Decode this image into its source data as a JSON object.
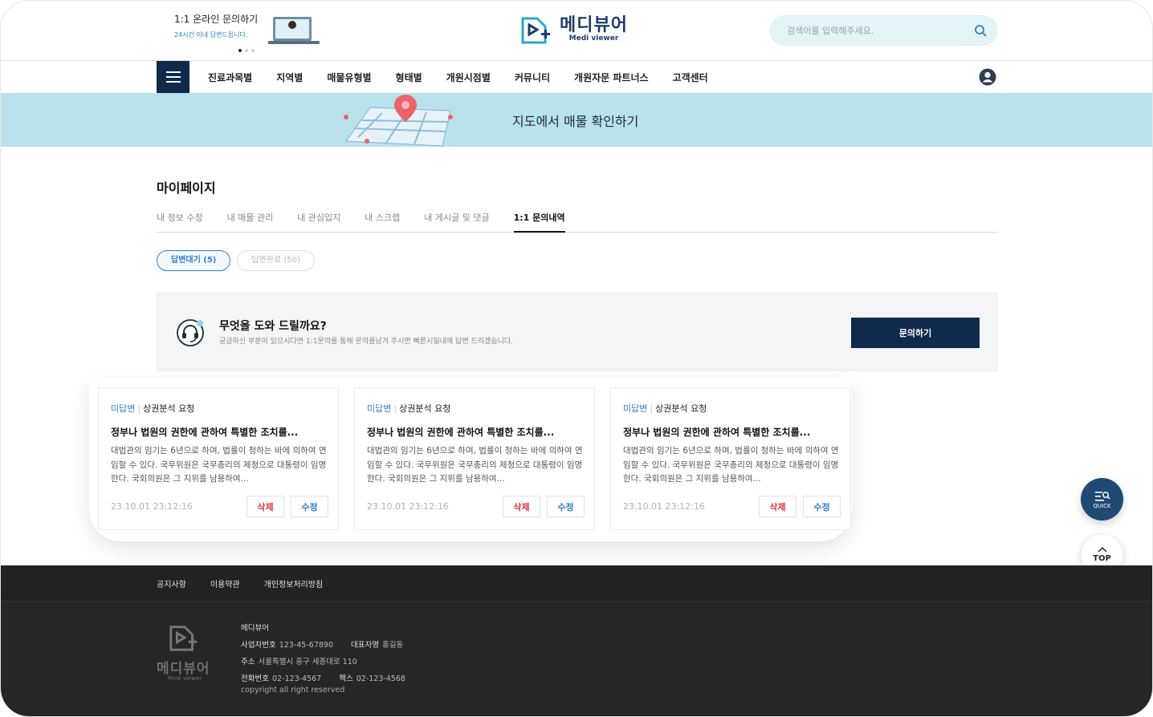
{
  "header": {
    "promo_title": "1:1 온라인 문의하기",
    "promo_sub": "24시간 이내 답변드립니다.",
    "logo_ko": "메디뷰어",
    "logo_en": "Medi viewer",
    "search_placeholder": "검색어를 입력해주세요."
  },
  "nav": {
    "items": [
      "진료과목별",
      "지역별",
      "매물유형별",
      "형태별",
      "개원시점별",
      "커뮤니티",
      "개원자문 파트너스",
      "고객센터"
    ]
  },
  "banner": {
    "text": "지도에서 매물 확인하기"
  },
  "mypage": {
    "title": "마이페이지",
    "tabs": [
      "내 정보 수정",
      "내 매물 관리",
      "내 관심입지",
      "내 스크랩",
      "내 게시글 및 댓글",
      "1:1 문의내역"
    ],
    "active_tab": "1:1 문의내역",
    "filters": [
      "답변대기 (5)",
      "답변완료 (50)"
    ]
  },
  "help": {
    "title": "무엇을 도와 드릴까요?",
    "desc": "궁금하신 부분이 있으시다면 1:1문의를 통해 문의를남겨 주시면 빠른시일내에 답변 드리겠습니다.",
    "button": "문의하기"
  },
  "cards": [
    {
      "status": "미답변",
      "category": "상권분석 요청",
      "title": "정부나 법원의 권한에 관하여 특별한 조치를...",
      "body": "대법관의 임기는 6년으로 하며, 법률이 정하는 바에 의하여 연임할 수 있다. 국무위원은 국무총리의 제청으로 대통령이 임명한다. 국회의원은 그 지위를 남용하여...",
      "date": "23.10.01 23:12:16",
      "delete": "삭제",
      "edit": "수정"
    },
    {
      "status": "미답변",
      "category": "상권분석 요청",
      "title": "정부나 법원의 권한에 관하여 특별한 조치를...",
      "body": "대법관의 임기는 6년으로 하며, 법률이 정하는 바에 의하여 연임할 수 있다. 국무위원은 국무총리의 제청으로 대통령이 임명한다. 국회의원은 그 지위를 남용하여...",
      "date": "23.10.01 23:12:16",
      "delete": "삭제",
      "edit": "수정"
    },
    {
      "status": "미답변",
      "category": "상권분석 요청",
      "title": "정부나 법원의 권한에 관하여 특별한 조치를...",
      "body": "대법관의 임기는 6년으로 하며, 법률이 정하는 바에 의하여 연임할 수 있다. 국무위원은 국무총리의 제청으로 대통령이 임명한다. 국회의원은 그 지위를 남용하여...",
      "date": "23.10.01 23:12:16",
      "delete": "삭제",
      "edit": "수정"
    }
  ],
  "floating": {
    "quick": "QUICK",
    "top": "TOP"
  },
  "footer": {
    "links": [
      "공지사항",
      "이용약관",
      "개인정보처리방침"
    ],
    "logo_ko": "메디뷰어",
    "logo_en": "Medi viewer",
    "company": "메디뷰어",
    "biz_label": "사업자번호",
    "biz_no": "123-45-67890",
    "ceo_label": "대표자명",
    "ceo": "홍길동",
    "addr_label": "주소",
    "addr": "서울특별시 중구 세종대로 110",
    "tel_label": "전화번호",
    "tel": "02-123-4567",
    "fax_label": "팩스",
    "fax": "02-123-4568",
    "copyright": "copyright all right reserved"
  },
  "colors": {
    "navy": "#0f2a4d",
    "accent_blue": "#2f7fc6",
    "banner_bg": "#b9e2ec",
    "delete_red": "#d9363e"
  },
  "icons": [
    "search-icon",
    "menu-icon",
    "user-icon",
    "headset-icon",
    "quick-search-icon",
    "chevron-up-icon",
    "logo-icon",
    "map-pin-icon"
  ]
}
